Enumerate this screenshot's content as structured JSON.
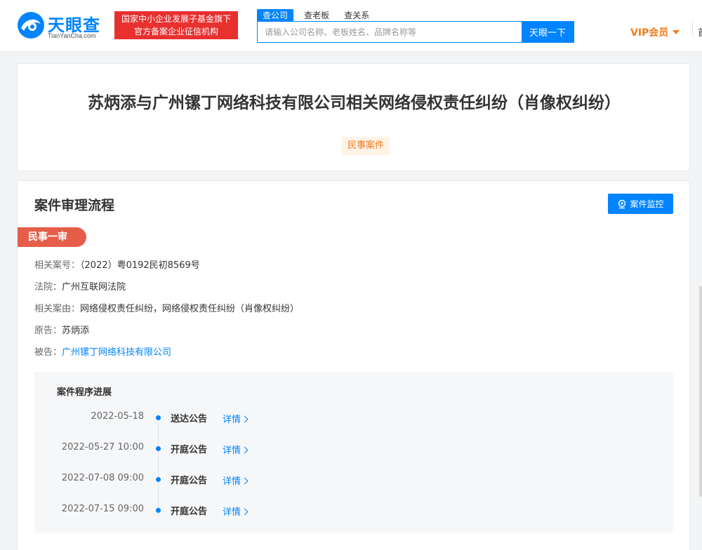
{
  "header": {
    "logo_text": "天眼查",
    "logo_sub": "TianYanCha.com",
    "gov_badge_line1": "国家中小企业发展子基金旗下",
    "gov_badge_line2": "官方备案企业征信机构",
    "search_tabs": [
      "查公司",
      "查老板",
      "查关系"
    ],
    "search_placeholder": "请输入公司名称、老板姓名、品牌名称等",
    "search_button": "天眼一下",
    "vip_label": "VIP会员",
    "edge_text": "首"
  },
  "case": {
    "title": "苏炳添与广州镙丁网络科技有限公司相关网络侵权责任纠纷（肖像权纠纷）",
    "tag": "民事案件"
  },
  "flow": {
    "section_title": "案件审理流程",
    "monitor_button": "案件监控",
    "stage": "民事一审",
    "info": [
      {
        "label": "相关案号：",
        "value": "（2022）粤0192民初8569号",
        "link": false
      },
      {
        "label": "法院：",
        "value": "广州互联网法院",
        "link": false
      },
      {
        "label": "相关案由：",
        "value": "网络侵权责任纠纷，网络侵权责任纠纷（肖像权纠纷）",
        "link": false
      },
      {
        "label": "原告：",
        "value": "苏炳添",
        "link": false
      },
      {
        "label": "被告：",
        "value": "广州镙丁网络科技有限公司",
        "link": true
      }
    ],
    "progress_title": "案件程序进展",
    "timeline": [
      {
        "date": "2022-05-18",
        "event": "送达公告",
        "detail": "详情"
      },
      {
        "date": "2022-05-27 10:00",
        "event": "开庭公告",
        "detail": "详情"
      },
      {
        "date": "2022-07-08 09:00",
        "event": "开庭公告",
        "detail": "详情"
      },
      {
        "date": "2022-07-15 09:00",
        "event": "开庭公告",
        "detail": "详情"
      }
    ]
  },
  "colors": {
    "brand_blue": "#0084ff",
    "badge_red": "#e8302f",
    "ribbon_red": "#e65e4a",
    "vip_orange": "#f27b1a"
  },
  "icons": {
    "logo": "tianyancha-eye-logo",
    "monitor": "location-pin-icon",
    "vip_caret": "caret-down-icon",
    "detail": "chevron-right-icon"
  }
}
